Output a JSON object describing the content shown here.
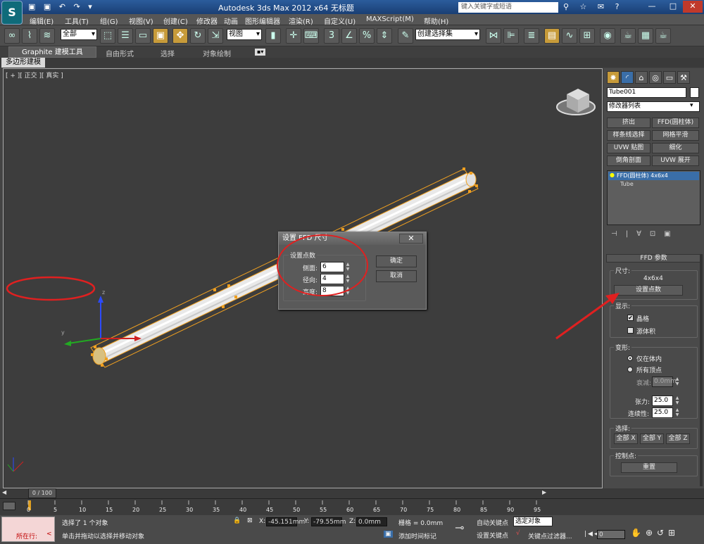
{
  "titlebar": {
    "app_title": "Autodesk 3ds Max  2012 x64    无标题",
    "search_placeholder": "键入关键字或短语",
    "min": "—",
    "max": "□",
    "close": "✕"
  },
  "menu": [
    "编辑(E)",
    "工具(T)",
    "组(G)",
    "视图(V)",
    "创建(C)",
    "修改器",
    "动画",
    "图形编辑器",
    "渲染(R)",
    "自定义(U)",
    "MAXScript(M)",
    "帮助(H)"
  ],
  "toolbar": {
    "selection_filter": "全部",
    "reference_coord": "视图",
    "named_selection": "创建选择集"
  },
  "ribbon": {
    "tabs": [
      "Graphite 建模工具",
      "自由形式",
      "选择",
      "对象绘制"
    ],
    "subtab": "多边形建模"
  },
  "viewport": {
    "label": "[ + ][ 正交 ][ 真实 ]"
  },
  "panel": {
    "object_name": "Tube001",
    "modifier_list": "修改器列表",
    "modifier_buttons": [
      "挤出",
      "FFD(圆柱体)",
      "样条线选择",
      "网格平滑",
      "UVW 贴图",
      "细化",
      "倒角剖面",
      "UVW 展开"
    ],
    "stack": [
      "FFD(圆柱体) 4x6x4",
      "Tube"
    ],
    "rollout_title": "FFD 参数",
    "dimensions_label": "尺寸:",
    "dimensions_value": "4x6x4",
    "set_points_button": "设置点数",
    "display_label": "显示:",
    "lattice_label": "晶格",
    "source_volume_label": "源体积",
    "deform_label": "变形:",
    "only_in_volume": "仅在体内",
    "all_vertices": "所有顶点",
    "falloff_label": "衰减:",
    "falloff_value": "0.0mm",
    "tension_label": "张力:",
    "tension_value": "25.0",
    "continuity_label": "连续性:",
    "continuity_value": "25.0",
    "selection_label": "选择:",
    "all_x": "全部 X",
    "all_y": "全部 Y",
    "all_z": "全部 Z",
    "control_points_label": "控制点:",
    "reset_button": "重置"
  },
  "dialog": {
    "title": "设置 FFD 尺寸",
    "group_label": "设置点数",
    "side_label": "侧面:",
    "side_value": "6",
    "radial_label": "径向:",
    "radial_value": "4",
    "height_label": "高度:",
    "height_value": "8",
    "ok_button": "确定",
    "cancel_button": "取消",
    "close": "✕"
  },
  "timeline": {
    "frame_counter": "0 / 100",
    "ticks": [
      "0",
      "5",
      "10",
      "15",
      "20",
      "25",
      "30",
      "35",
      "40",
      "45",
      "50",
      "55",
      "60",
      "65",
      "70",
      "75",
      "80",
      "85",
      "90",
      "95"
    ]
  },
  "status": {
    "running": "所在行:",
    "selected_text": "选择了 1 个对象",
    "prompt_text": "单击并拖动以选择并移动对象",
    "x_label": "X:",
    "x_value": "-45.151mm",
    "y_label": "Y:",
    "y_value": "-79.55mm",
    "z_label": "Z:",
    "z_value": "0.0mm",
    "grid": "栅格 = 0.0mm",
    "add_time_tag": "添加时间标记",
    "auto_key": "自动关键点",
    "set_key": "设置关键点",
    "selected_dropdown": "选定对象",
    "key_filters": "关键点过滤器...",
    "frame_value": "0"
  }
}
